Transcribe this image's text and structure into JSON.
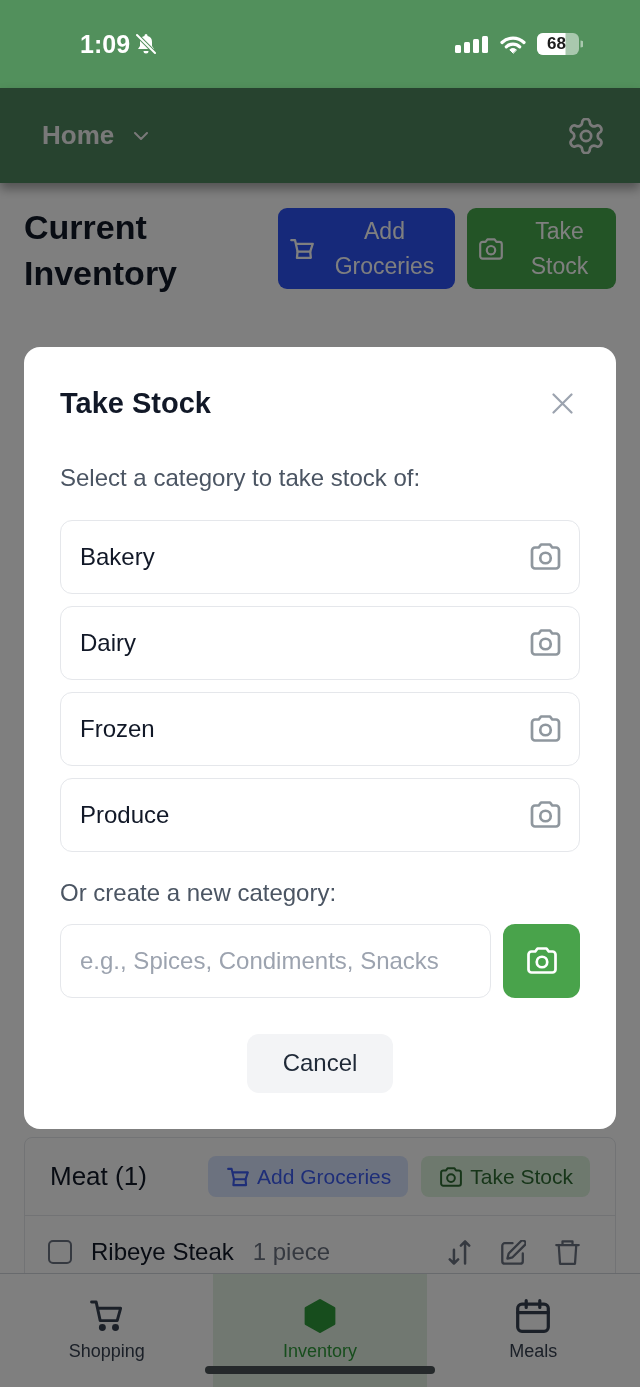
{
  "status_bar": {
    "time": "1:09",
    "battery": "68"
  },
  "header": {
    "menu": "Home"
  },
  "inventory": {
    "title": "Current Inventory",
    "actions": [
      {
        "kind": "add",
        "label": "Add Groceries"
      },
      {
        "kind": "stock",
        "label": "Take Stock"
      }
    ],
    "category": {
      "title": "Meat (1)",
      "actions": [
        {
          "kind": "add",
          "label": "Add Groceries"
        },
        {
          "kind": "stock",
          "label": "Take Stock"
        }
      ],
      "items": [
        {
          "name": "Ribeye Steak",
          "quantity": "1 piece",
          "checked": false
        }
      ]
    }
  },
  "bottom_nav": [
    {
      "label": "Shopping",
      "selected": false
    },
    {
      "label": "Inventory",
      "selected": true
    },
    {
      "label": "Meals",
      "selected": false
    }
  ],
  "dialog": {
    "title": "Take Stock",
    "prompt": "Select a category to take stock of:",
    "categories": [
      {
        "name": "Bakery"
      },
      {
        "name": "Dairy"
      },
      {
        "name": "Frozen"
      },
      {
        "name": "Produce"
      }
    ],
    "new_category": {
      "label": "Or create a new category:",
      "placeholder": "e.g., Spices, Condiments, Snacks"
    },
    "cancel": "Cancel"
  }
}
